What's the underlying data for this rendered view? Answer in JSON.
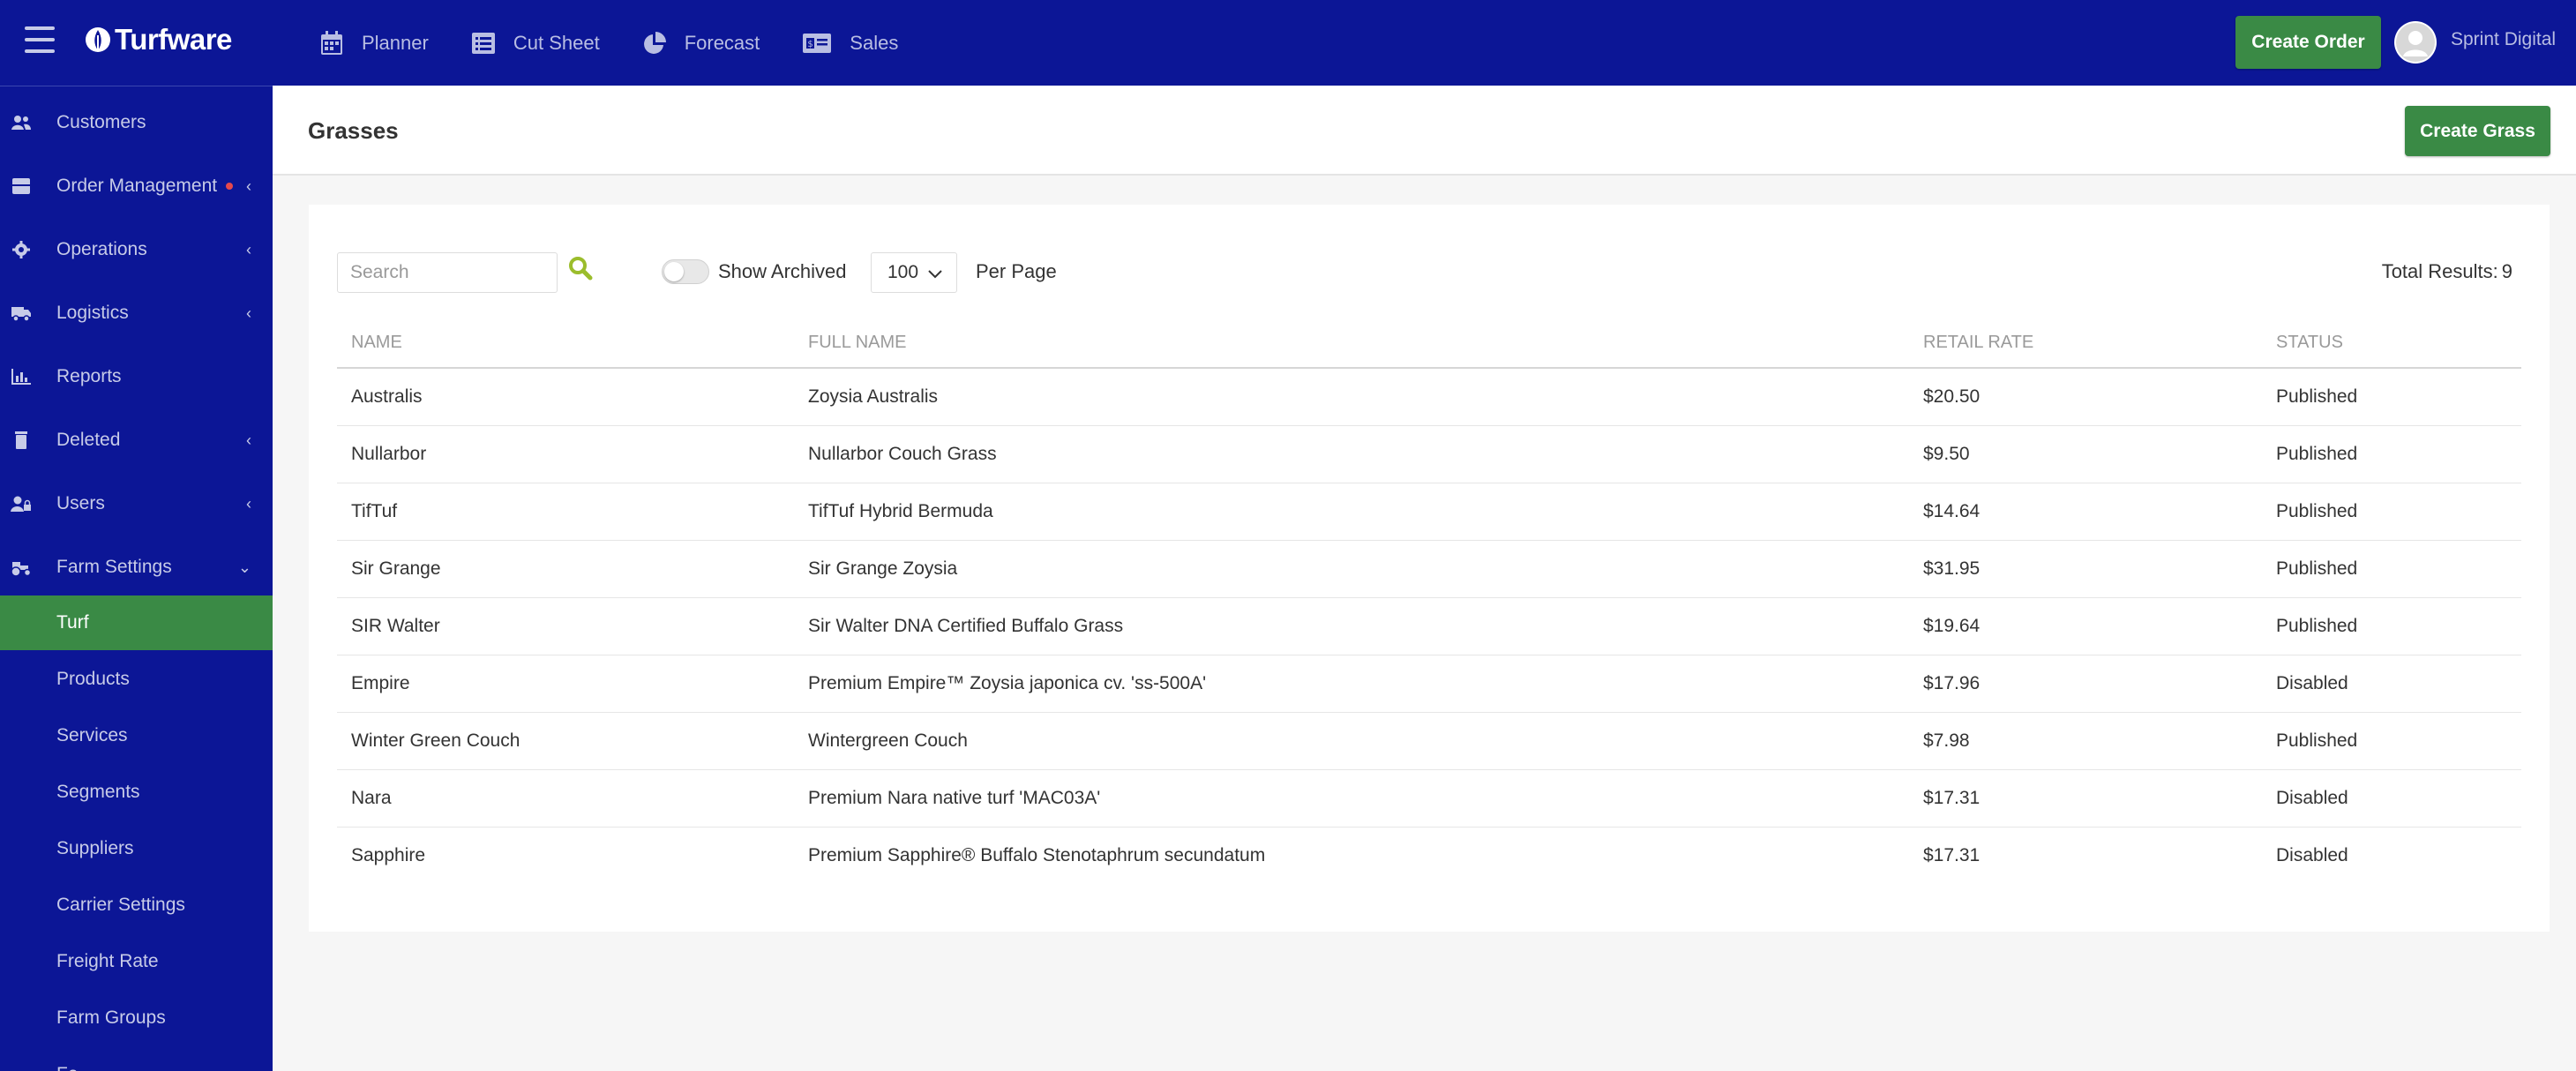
{
  "app": {
    "name": "Turfware"
  },
  "topnav": [
    {
      "label": "Planner",
      "icon": "calendar-icon"
    },
    {
      "label": "Cut Sheet",
      "icon": "list-icon"
    },
    {
      "label": "Forecast",
      "icon": "pie-chart-icon"
    },
    {
      "label": "Sales",
      "icon": "money-icon"
    }
  ],
  "header": {
    "create_order": "Create Order",
    "user": "Sprint Digital"
  },
  "sidebar": {
    "items": [
      {
        "label": "Customers",
        "icon": "users-icon",
        "chevron": ""
      },
      {
        "label": "Order Management",
        "icon": "box-icon",
        "chevron": "‹"
      },
      {
        "label": "Operations",
        "icon": "gear-icon",
        "chevron": "‹"
      },
      {
        "label": "Logistics",
        "icon": "truck-icon",
        "chevron": "‹"
      },
      {
        "label": "Reports",
        "icon": "chart-icon",
        "chevron": ""
      },
      {
        "label": "Deleted",
        "icon": "trash-icon",
        "chevron": "‹"
      },
      {
        "label": "Users",
        "icon": "user-lock-icon",
        "chevron": "‹"
      },
      {
        "label": "Farm Settings",
        "icon": "tractor-icon",
        "chevron": "⌄"
      }
    ],
    "sub_items": [
      "Turf",
      "Products",
      "Services",
      "Segments",
      "Suppliers",
      "Carrier Settings",
      "Freight Rate",
      "Farm Groups",
      "Fe..."
    ]
  },
  "page": {
    "title": "Grasses",
    "create_button": "Create Grass"
  },
  "filters": {
    "search_placeholder": "Search",
    "show_archived": "Show Archived",
    "per_page_value": "100",
    "per_page_label": "Per Page",
    "total_label": "Total Results:",
    "total_value": "9"
  },
  "table": {
    "columns": [
      "Name",
      "Full Name",
      "Retail Rate",
      "Status"
    ],
    "rows": [
      [
        "Australis",
        "Zoysia Australis",
        "$20.50",
        "Published"
      ],
      [
        "Nullarbor",
        "Nullarbor Couch Grass",
        "$9.50",
        "Published"
      ],
      [
        "TifTuf",
        "TifTuf Hybrid Bermuda",
        "$14.64",
        "Published"
      ],
      [
        "Sir Grange",
        "Sir Grange Zoysia",
        "$31.95",
        "Published"
      ],
      [
        "SIR Walter",
        "Sir Walter DNA Certified Buffalo Grass",
        "$19.64",
        "Published"
      ],
      [
        "Empire",
        "Premium Empire™ Zoysia japonica cv. 'ss-500A'",
        "$17.96",
        "Disabled"
      ],
      [
        "Winter Green Couch",
        "Wintergreen Couch",
        "$7.98",
        "Published"
      ],
      [
        "Nara",
        "Premium Nara native turf 'MAC03A'",
        "$17.31",
        "Disabled"
      ],
      [
        "Sapphire",
        "Premium Sapphire® Buffalo Stenotaphrum secundatum",
        "$17.31",
        "Disabled"
      ]
    ]
  },
  "colors": {
    "primary": "#0c1696",
    "accent": "#3a8a45",
    "search_icon": "#9bbd2c"
  }
}
